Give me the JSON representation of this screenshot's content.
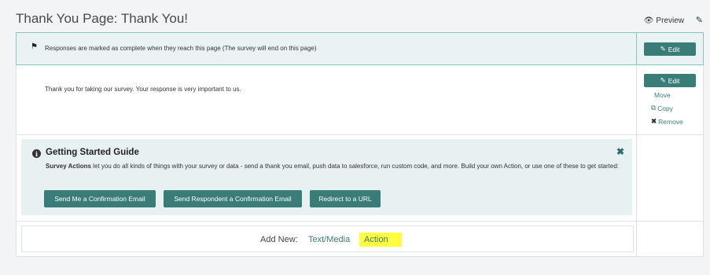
{
  "header": {
    "title": "Thank You Page: Thank You!",
    "preview_label": "Preview",
    "preview_icon": "eye-icon",
    "edit_icon": "pencil-icon"
  },
  "rows": {
    "completion": {
      "icon": "flag-icon",
      "text": "Responses are marked as complete when they reach this page (The survey will end on this page)",
      "edit_label": "Edit"
    },
    "message": {
      "text": "Thank you for taking our survey. Your response is very important to us.",
      "edit_label": "Edit",
      "move_label": "Move",
      "copy_label": "Copy",
      "remove_label": "Remove"
    }
  },
  "guide": {
    "title": "Getting Started Guide",
    "desc_bold": "Survey Actions",
    "desc_rest": " let you do all kinds of things with your survey or data - send a thank you email, push data to salesforce, run custom code, and more. Build your own Action, or use one of these to get started:",
    "buttons": [
      "Send Me a Confirmation Email",
      "Send Respondent a Confirmation Email",
      "Redirect to a URL"
    ]
  },
  "add_new": {
    "label": "Add New:",
    "text_media": "Text/Media",
    "action": "Action"
  },
  "colors": {
    "accent": "#3a7c78",
    "highlight": "#fefe3f",
    "selected_row_bg": "#eaf3f4"
  }
}
